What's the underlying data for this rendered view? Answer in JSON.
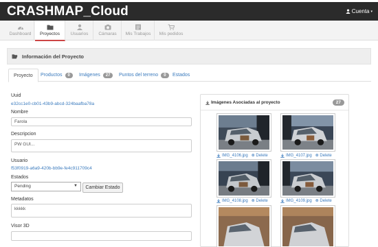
{
  "app": {
    "title": "CRASHMAP_Cloud",
    "account_label": "Cuenta"
  },
  "nav": {
    "items": [
      {
        "label": "Dashboard",
        "icon": "dashboard-icon",
        "active": false
      },
      {
        "label": "Proyectos",
        "icon": "folder-icon",
        "active": true
      },
      {
        "label": "Usuarios",
        "icon": "user-icon",
        "active": false
      },
      {
        "label": "Cámaras",
        "icon": "camera-icon",
        "active": false
      },
      {
        "label": "Mis Trabajos",
        "icon": "list-icon",
        "active": false
      },
      {
        "label": "Mis pedidos",
        "icon": "cart-icon",
        "active": false
      }
    ]
  },
  "panel": {
    "title": "Información del Proyecto"
  },
  "tabs": [
    {
      "label": "Proyecto",
      "badge": ""
    },
    {
      "label": "Productos",
      "badge": "0"
    },
    {
      "label": "Imágenes",
      "badge": "27"
    },
    {
      "label": "Puntos del terreno",
      "badge": "0"
    },
    {
      "label": "Estados",
      "badge": ""
    }
  ],
  "form": {
    "uuid_label": "Uuid",
    "uuid_value": "e32cc1e0-cb01-43b9-abcd-324baafba78a",
    "nombre_label": "Nombre",
    "nombre_value": "Farola",
    "descripcion_label": "Descripcion",
    "descripcion_value": "PW GUI...",
    "usuario_label": "Usuario",
    "usuario_value": "f53f0919-a6a9-420b-bb9e-fe4c911709c4",
    "estados_label": "Estados",
    "estado_selected": "Pending",
    "cambiar_button": "Cambiar Estado",
    "metadatos_label": "Metadatos",
    "metadatos_value": "kkkkk",
    "visor_label": "Visor 3D"
  },
  "images": {
    "title": "Imágenes Asociadas al proyecto",
    "count": "27",
    "delete_label": "Delete",
    "files": [
      "IMG_4106.jpg",
      "IMG_4107.jpg",
      "IMG_4108.jpg",
      "IMG_4109.jpg",
      "",
      ""
    ]
  },
  "colors": {
    "topbar": "#2b2b2b",
    "link": "#3a7abd",
    "active_tab_underline": "#c44444"
  }
}
